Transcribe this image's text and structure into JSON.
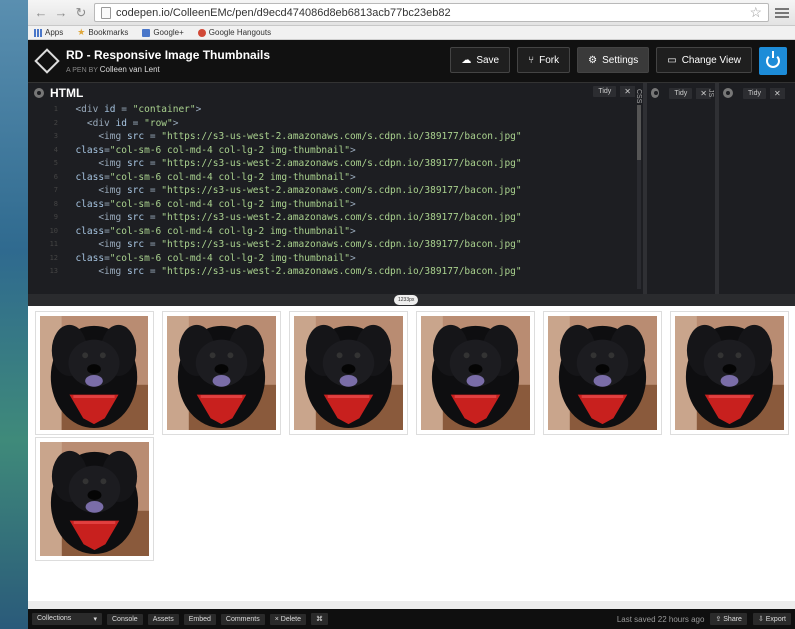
{
  "browser": {
    "url": "codepen.io/ColleenEMc/pen/d9ecd474086d8eb6813acb77bc23eb82",
    "bookmarks": [
      {
        "label": "Apps",
        "icon": "apps-icon"
      },
      {
        "label": "Bookmarks",
        "icon": "bookmark-star-icon"
      },
      {
        "label": "Google+",
        "icon": "google-plus-icon"
      },
      {
        "label": "Google Hangouts",
        "icon": "hangouts-icon"
      }
    ]
  },
  "pen": {
    "title": "RD - Responsive Image Thumbnails",
    "by_label": "A PEN BY",
    "author": "Colleen van Lent",
    "actions": {
      "save": "Save",
      "fork": "Fork",
      "settings": "Settings",
      "change_view": "Change View"
    }
  },
  "editors": {
    "html_title": "HTML",
    "tidy": "Tidy",
    "close": "✕",
    "css_label": "CSS",
    "js_label": "JS",
    "lines": [
      {
        "indent": "  ",
        "parts": [
          [
            "tag",
            "<div "
          ],
          [
            "attr",
            "id"
          ],
          [
            "tag",
            " = "
          ],
          [
            "str",
            "\"container\""
          ],
          [
            "tag",
            ">"
          ]
        ]
      },
      {
        "indent": "    ",
        "parts": [
          [
            "tag",
            "<div "
          ],
          [
            "attr",
            "id"
          ],
          [
            "tag",
            " = "
          ],
          [
            "str",
            "\"row\""
          ],
          [
            "tag",
            ">"
          ]
        ]
      },
      {
        "indent": "      ",
        "parts": [
          [
            "tag",
            "<img "
          ],
          [
            "attr",
            "src"
          ],
          [
            "tag",
            " = "
          ],
          [
            "str",
            "\"https://s3-us-west-2.amazonaws.com/s.cdpn.io/389177/bacon.jpg\""
          ]
        ]
      },
      {
        "indent": "  ",
        "parts": [
          [
            "attr",
            "class"
          ],
          [
            "tag",
            "="
          ],
          [
            "str",
            "\"col-sm-6 col-md-4 col-lg-2 img-thumbnail\""
          ],
          [
            "tag",
            ">"
          ]
        ]
      },
      {
        "indent": "      ",
        "parts": [
          [
            "tag",
            "<img "
          ],
          [
            "attr",
            "src"
          ],
          [
            "tag",
            " = "
          ],
          [
            "str",
            "\"https://s3-us-west-2.amazonaws.com/s.cdpn.io/389177/bacon.jpg\""
          ]
        ]
      },
      {
        "indent": "  ",
        "parts": [
          [
            "attr",
            "class"
          ],
          [
            "tag",
            "="
          ],
          [
            "str",
            "\"col-sm-6 col-md-4 col-lg-2 img-thumbnail\""
          ],
          [
            "tag",
            ">"
          ]
        ]
      },
      {
        "indent": "      ",
        "parts": [
          [
            "tag",
            "<img "
          ],
          [
            "attr",
            "src"
          ],
          [
            "tag",
            " = "
          ],
          [
            "str",
            "\"https://s3-us-west-2.amazonaws.com/s.cdpn.io/389177/bacon.jpg\""
          ]
        ]
      },
      {
        "indent": "  ",
        "parts": [
          [
            "attr",
            "class"
          ],
          [
            "tag",
            "="
          ],
          [
            "str",
            "\"col-sm-6 col-md-4 col-lg-2 img-thumbnail\""
          ],
          [
            "tag",
            ">"
          ]
        ]
      },
      {
        "indent": "      ",
        "parts": [
          [
            "tag",
            "<img "
          ],
          [
            "attr",
            "src"
          ],
          [
            "tag",
            " = "
          ],
          [
            "str",
            "\"https://s3-us-west-2.amazonaws.com/s.cdpn.io/389177/bacon.jpg\""
          ]
        ]
      },
      {
        "indent": "  ",
        "parts": [
          [
            "attr",
            "class"
          ],
          [
            "tag",
            "="
          ],
          [
            "str",
            "\"col-sm-6 col-md-4 col-lg-2 img-thumbnail\""
          ],
          [
            "tag",
            ">"
          ]
        ]
      },
      {
        "indent": "      ",
        "parts": [
          [
            "tag",
            "<img "
          ],
          [
            "attr",
            "src"
          ],
          [
            "tag",
            " = "
          ],
          [
            "str",
            "\"https://s3-us-west-2.amazonaws.com/s.cdpn.io/389177/bacon.jpg\""
          ]
        ]
      },
      {
        "indent": "  ",
        "parts": [
          [
            "attr",
            "class"
          ],
          [
            "tag",
            "="
          ],
          [
            "str",
            "\"col-sm-6 col-md-4 col-lg-2 img-thumbnail\""
          ],
          [
            "tag",
            ">"
          ]
        ]
      },
      {
        "indent": "      ",
        "parts": [
          [
            "tag",
            "<img "
          ],
          [
            "attr",
            "src"
          ],
          [
            "tag",
            " = "
          ],
          [
            "str",
            "\"https://s3-us-west-2.amazonaws.com/s.cdpn.io/389177/bacon.jpg\""
          ]
        ]
      }
    ]
  },
  "preview": {
    "width_label": "1233px",
    "thumbnail_count": 7
  },
  "bottom": {
    "collections": "Collections",
    "console": "Console",
    "assets": "Assets",
    "embed": "Embed",
    "comments": "Comments",
    "delete": "Delete",
    "shortcuts": "⌘",
    "last_saved": "Last saved 22 hours ago",
    "share": "Share",
    "export": "Export"
  },
  "colors": {
    "codepen_header": "#111111",
    "editor_bg": "#1d1e22",
    "accent_blue": "#1d8cd8"
  }
}
